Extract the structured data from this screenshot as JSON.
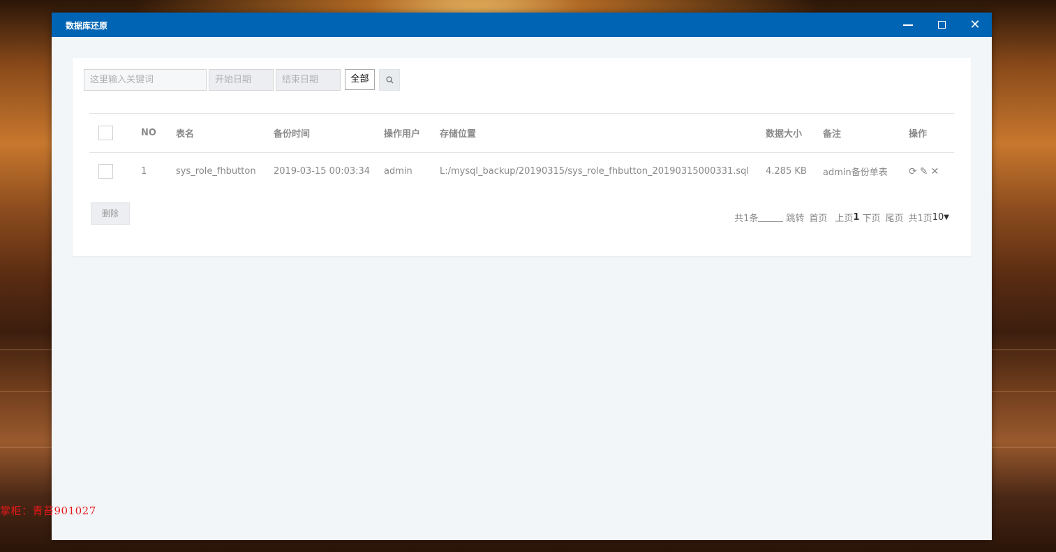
{
  "window": {
    "title": "数据库还原",
    "controls": {
      "minimize": "minimize-icon",
      "maximize": "maximize-icon",
      "close": "close-icon"
    },
    "titlebar_color": "#0064b4"
  },
  "toolbar": {
    "keyword_placeholder": "这里输入关键词",
    "start_date_placeholder": "开始日期",
    "end_date_placeholder": "结束日期",
    "filter_selected": "全部",
    "search_icon": "search-icon"
  },
  "table": {
    "headers": {
      "no": "NO",
      "table_name": "表名",
      "backup_time": "备份时间",
      "operator": "操作用户",
      "location": "存储位置",
      "size": "数据大小",
      "remark": "备注",
      "ops": "操作"
    },
    "rows": [
      {
        "no": "1",
        "table_name": "sys_role_fhbutton",
        "backup_time": "2019-03-15 00:03:34",
        "operator": "admin",
        "location": "L:/mysql_backup/20190315/sys_role_fhbutton_20190315000331.sql",
        "size": "4.285 KB",
        "remark": "admin备份单表",
        "op_icons": [
          "refresh-icon",
          "edit-icon",
          "delete-icon"
        ]
      }
    ]
  },
  "footer": {
    "delete_label": "删除",
    "pager": {
      "total": "共1条",
      "jump": "跳转",
      "first": "首页",
      "prev": "上页",
      "current": "1",
      "next": "下页",
      "last": "尾页",
      "pages": "共1页",
      "page_size": "10"
    }
  },
  "watermark": "掌柜：青苔901027"
}
